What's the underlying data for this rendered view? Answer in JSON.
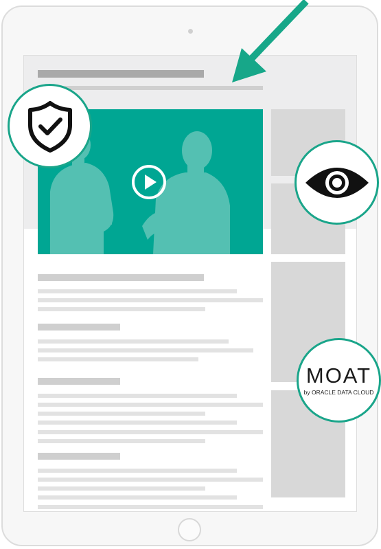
{
  "colors": {
    "accent": "#1aa58a",
    "video_bg": "#00a693",
    "arrow": "#17a789"
  },
  "icons": {
    "shield": "shield-check-icon",
    "eye": "eye-icon",
    "play": "play-icon",
    "arrow": "arrow-icon"
  },
  "moat": {
    "title": "MOAT",
    "subtitle": "by ORACLE DATA CLOUD"
  }
}
